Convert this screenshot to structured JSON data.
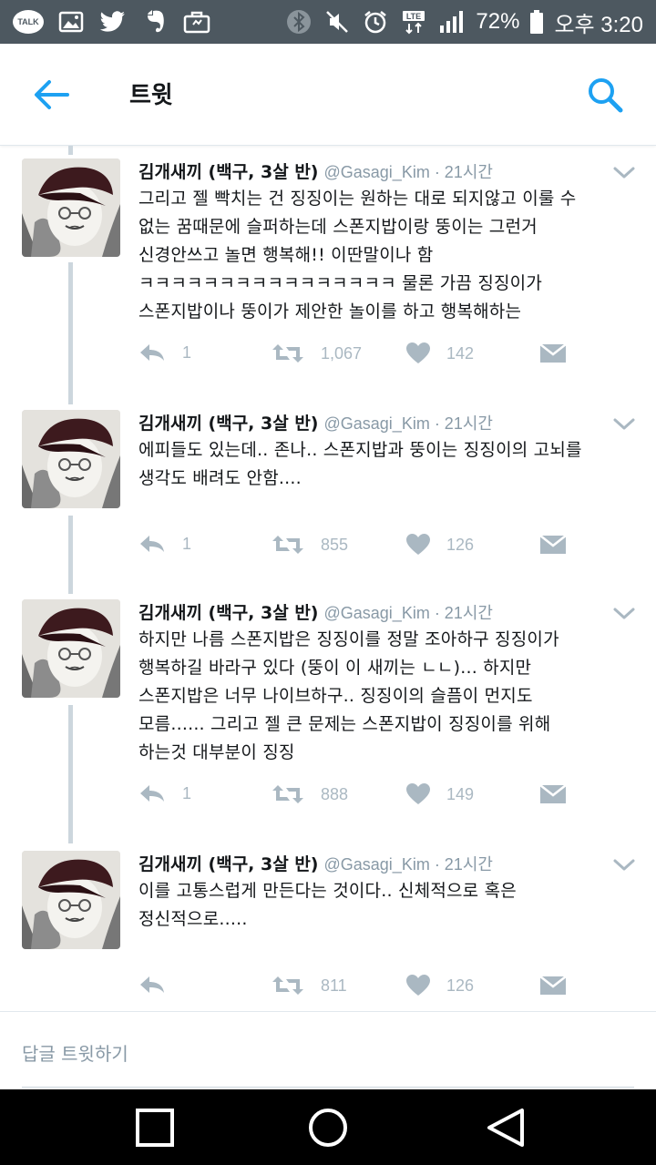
{
  "status_bar": {
    "battery": "72%",
    "time": "오후 3:20",
    "talk_label": "TALK",
    "icons": [
      "kakaotalk-icon",
      "gallery-icon",
      "twitter-icon",
      "evernote-icon",
      "briefcase-icon",
      "bluetooth-icon",
      "mute-icon",
      "alarm-icon",
      "lte-icon",
      "signal-icon",
      "battery-icon"
    ]
  },
  "header": {
    "title": "트윗"
  },
  "tweets": [
    {
      "name": "김개새끼 (백구, 3살 반)",
      "handle": "@Gasagi_Kim · 21시간",
      "lines": [
        "그리고 젤 빡치는 건 징징이는 원하는 대로 되지않고 이룰 수",
        "없는 꿈때문에 슬퍼하는데 스폰지밥이랑 뚱이는 그런거",
        "신경안쓰고 놀면 행복해!! 이딴말이나 함",
        "ㅋㅋㅋㅋㅋㅋㅋㅋㅋㅋㅋㅋㅋㅋㅋㅋ 물론 가끔 징징이가",
        "스폰지밥이나 뚱이가 제안한 놀이를 하고 행복해하는"
      ],
      "replies": "1",
      "retweets": "1,067",
      "likes": "142"
    },
    {
      "name": "김개새끼 (백구, 3살 반)",
      "handle": "@Gasagi_Kim · 21시간",
      "lines": [
        "에피들도 있는데.. 존나.. 스폰지밥과 뚱이는 징징이의 고뇌를",
        "생각도 배려도 안함...."
      ],
      "replies": "1",
      "retweets": "855",
      "likes": "126"
    },
    {
      "name": "김개새끼 (백구, 3살 반)",
      "handle": "@Gasagi_Kim · 21시간",
      "lines": [
        "하지만 나름 스폰지밥은 징징이를 정말 조아하구 징징이가",
        "행복하길 바라구 있다 (뚱이 이 새끼는 ㄴㄴ)... 하지만",
        "스폰지밥은 너무 나이브하구.. 징징이의 슬픔이 먼지도",
        "모름...... 그리고 젤 큰 문제는 스폰지밥이 징징이를 위해",
        "하는것 대부분이 징징"
      ],
      "replies": "1",
      "retweets": "888",
      "likes": "149"
    },
    {
      "name": "김개새끼 (백구, 3살 반)",
      "handle": "@Gasagi_Kim · 21시간",
      "lines": [
        "이를 고통스럽게 만든다는 것이다.. 신체적으로 혹은",
        "정신적으로....."
      ],
      "replies": "",
      "retweets": "811",
      "likes": "126"
    }
  ],
  "reply_bar": {
    "placeholder": "답글 트윗하기"
  },
  "colors": {
    "accent": "#1da1f2",
    "status_bar": "#4d5860",
    "action_gray": "#aab8c2",
    "handle_gray": "#8899a6",
    "thread_line": "#ccd6dd"
  }
}
